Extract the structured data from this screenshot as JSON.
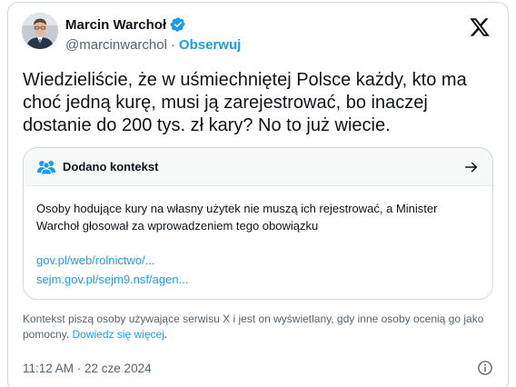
{
  "author": {
    "display_name": "Marcin Warchoł",
    "handle": "@marcinwarchol",
    "separator": "·",
    "follow_label": "Obserwuj"
  },
  "tweet": {
    "text": "Wiedzieliście, że w uśmiechniętej Polsce każdy, kto ma choć jedną kurę, musi ją zarejestrować, bo inaczej dostanie do 200 tys. zł kary? No to już wiecie."
  },
  "community_note": {
    "title": "Dodano kontekst",
    "body": "Osoby hodujące kury na własny użytek nie muszą ich rejestrować, a Minister Warchoł głosował za wprowadzeniem tego obowiązku",
    "links": [
      "gov.pl/web/rolnictwo/...",
      "sejm.gov.pl/sejm9.nsf/agen..."
    ]
  },
  "disclaimer": {
    "text": "Kontekst piszą osoby używające serwisu X i jest on wyświetlany, gdy inne osoby ocenią go jako pomocny.",
    "learn_more": "Dowiedz się więcej",
    "end": "."
  },
  "footer": {
    "timestamp": "11:12 AM · 22 cze 2024"
  },
  "icons": {
    "verified": "verified-badge-icon",
    "brand": "x-logo-icon",
    "people": "people-icon",
    "arrow": "arrow-right-icon",
    "info": "info-icon"
  },
  "colors": {
    "accent": "#1d9bf0",
    "text": "#0f1419",
    "secondary": "#536471",
    "border": "#cfd9de"
  }
}
